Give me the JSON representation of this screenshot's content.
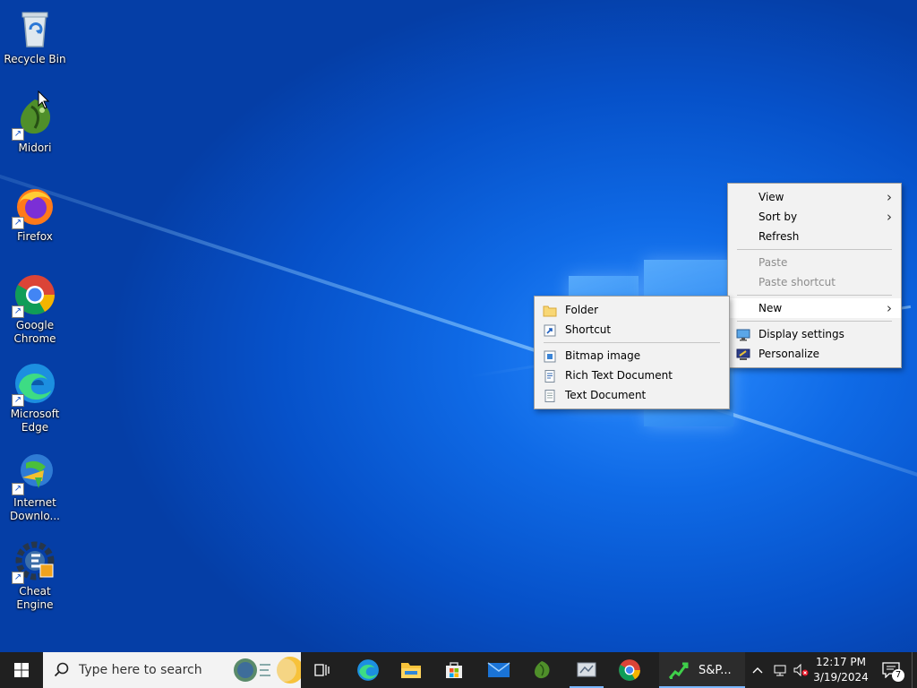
{
  "desktop": {
    "icons": [
      {
        "label": "Recycle Bin",
        "icon": "recycle-bin-icon"
      },
      {
        "label": "Midori",
        "icon": "midori-icon"
      },
      {
        "label": "Firefox",
        "icon": "firefox-icon"
      },
      {
        "label": "Google Chrome",
        "icon": "chrome-icon"
      },
      {
        "label": "Microsoft Edge",
        "icon": "edge-icon"
      },
      {
        "label": "Internet Downlo...",
        "icon": "internet-download-manager-icon"
      },
      {
        "label": "Cheat Engine",
        "icon": "cheat-engine-icon"
      }
    ]
  },
  "context_menu": {
    "items": [
      {
        "label": "View",
        "submenu": true
      },
      {
        "label": "Sort by",
        "submenu": true
      },
      {
        "label": "Refresh"
      },
      {
        "label": "Paste",
        "disabled": true
      },
      {
        "label": "Paste shortcut",
        "disabled": true
      },
      {
        "label": "New",
        "submenu": true,
        "highlighted": true
      },
      {
        "label": "Display settings",
        "icon": "display-settings-icon"
      },
      {
        "label": "Personalize",
        "icon": "personalize-icon"
      }
    ]
  },
  "new_submenu": {
    "items": [
      {
        "label": "Folder",
        "icon": "folder-icon"
      },
      {
        "label": "Shortcut",
        "icon": "shortcut-icon"
      },
      {
        "label": "Bitmap image",
        "icon": "bitmap-image-icon"
      },
      {
        "label": "Rich Text Document",
        "icon": "rich-text-document-icon"
      },
      {
        "label": "Text Document",
        "icon": "text-document-icon"
      }
    ]
  },
  "taskbar": {
    "search_placeholder": "Type here to search",
    "pinned": [
      "task-view-icon",
      "edge-icon",
      "file-explorer-icon",
      "microsoft-store-icon",
      "mail-icon",
      "midori-icon",
      "app-icon",
      "chrome-icon"
    ],
    "running_app_label": "S&P...",
    "clock_time": "12:17 PM",
    "clock_date": "3/19/2024",
    "notification_count": "7"
  },
  "colors": {
    "accent": "#0078d7",
    "taskbar": "#202020",
    "menu_bg": "#f2f2f2"
  }
}
